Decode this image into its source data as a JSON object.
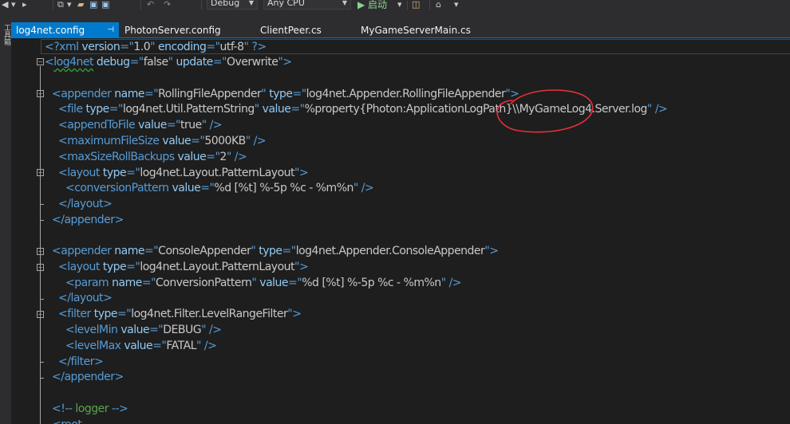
{
  "toolbar": {
    "config_value": "Debug",
    "platform_value": "Any CPU",
    "start_label": "▶ 启动"
  },
  "side_panel": {
    "label": "工具箱"
  },
  "tabs": [
    {
      "label": "log4net.config",
      "active": true
    },
    {
      "label": "PhotonServer.config",
      "active": false
    },
    {
      "label": "ClientPeer.cs",
      "active": false
    },
    {
      "label": "MyGameServerMain.cs",
      "active": false
    }
  ],
  "code": {
    "l1": [
      "<?",
      "xml",
      " version",
      "=\"",
      "1.0",
      "\"",
      " encoding",
      "=\"",
      "utf-8",
      "\"",
      " ?>"
    ],
    "l2": [
      "<",
      "log4net",
      " debug",
      "=\"",
      "false",
      "\"",
      " update",
      "=\"",
      "Overwrite",
      "\"",
      ">"
    ],
    "l4": [
      "<",
      "appender",
      " name",
      "=\"",
      "RollingFileAppender",
      "\"",
      " type",
      "=\"",
      "log4net.Appender.RollingFileAppender",
      "\"",
      ">"
    ],
    "l5": [
      "<",
      "file",
      " type",
      "=\"",
      "log4net.Util.PatternString",
      "\"",
      " value",
      "=\"",
      "%property{Photon:ApplicationLogPath}\\\\MyGameLog4.Server.log",
      "\"",
      " />"
    ],
    "l6": [
      "<",
      "appendToFile",
      " value",
      "=\"",
      "true",
      "\"",
      " />"
    ],
    "l7": [
      "<",
      "maximumFileSize",
      " value",
      "=\"",
      "5000KB",
      "\"",
      " />"
    ],
    "l8": [
      "<",
      "maxSizeRollBackups",
      " value",
      "=\"",
      "2",
      "\"",
      " />"
    ],
    "l9": [
      "<",
      "layout",
      " type",
      "=\"",
      "log4net.Layout.PatternLayout",
      "\"",
      ">"
    ],
    "l10": [
      "<",
      "conversionPattern",
      " value",
      "=\"",
      "%d [%t] %-5p %c - %m%n",
      "\"",
      " />"
    ],
    "l11": [
      "</",
      "layout",
      ">"
    ],
    "l12": [
      "</",
      "appender",
      ">"
    ],
    "l14": [
      "<",
      "appender",
      " name",
      "=\"",
      "ConsoleAppender",
      "\"",
      " type",
      "=\"",
      "log4net.Appender.ConsoleAppender",
      "\"",
      ">"
    ],
    "l15": [
      "<",
      "layout",
      " type",
      "=\"",
      "log4net.Layout.PatternLayout",
      "\"",
      ">"
    ],
    "l16": [
      "<",
      "param",
      " name",
      "=\"",
      "ConversionPattern",
      "\"",
      " value",
      "=\"",
      "%d [%t] %-5p %c - %m%n",
      "\"",
      " />"
    ],
    "l17": [
      "</",
      "layout",
      ">"
    ],
    "l18": [
      "<",
      "filter",
      " type",
      "=\"",
      "log4net.Filter.LevelRangeFilter",
      "\"",
      ">"
    ],
    "l19": [
      "<",
      "levelMin",
      " value",
      "=\"",
      "DEBUG",
      "\"",
      " />"
    ],
    "l20": [
      "<",
      "levelMax",
      " value",
      "=\"",
      "FATAL",
      "\"",
      " />"
    ],
    "l21": [
      "</",
      "filter",
      ">"
    ],
    "l22": [
      "</",
      "appender",
      ">"
    ],
    "l24": [
      "<!--",
      " logger ",
      "-->"
    ],
    "l25": [
      "<",
      "root"
    ]
  }
}
